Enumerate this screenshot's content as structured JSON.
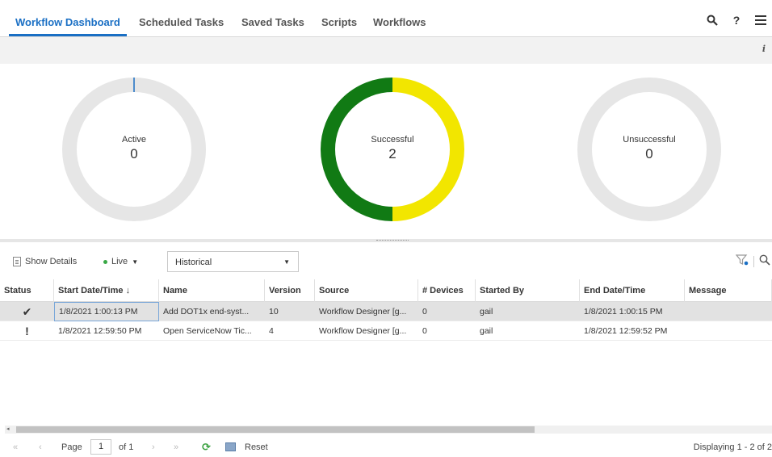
{
  "tabs": [
    {
      "label": "Workflow Dashboard",
      "active": true
    },
    {
      "label": "Scheduled Tasks"
    },
    {
      "label": "Saved Tasks"
    },
    {
      "label": "Scripts"
    },
    {
      "label": "Workflows"
    }
  ],
  "top_icons": [
    "search-icon",
    "help-icon",
    "menu-icon"
  ],
  "info_label": "i",
  "donuts": [
    {
      "label": "Active",
      "value": "0",
      "segments": [
        {
          "fraction": 1.0,
          "color": "#e6e6e6"
        }
      ],
      "marker_color": "#1a6fc4"
    },
    {
      "label": "Successful",
      "value": "2",
      "segments": [
        {
          "fraction": 0.5,
          "color": "#f2e600"
        },
        {
          "fraction": 0.5,
          "color": "#117a14"
        }
      ]
    },
    {
      "label": "Unsuccessful",
      "value": "0",
      "segments": [
        {
          "fraction": 1.0,
          "color": "#e6e6e6"
        }
      ]
    }
  ],
  "toolbar": {
    "show_details": "Show Details",
    "live": "Live",
    "select_value": "Historical"
  },
  "table": {
    "sort_indicator": "↓",
    "headers": [
      "Status",
      "Start Date/Time",
      "Name",
      "Version",
      "Source",
      "# Devices",
      "Started By",
      "End Date/Time",
      "Message"
    ],
    "rows": [
      {
        "status": "✔",
        "start": "1/8/2021 1:00:13 PM",
        "name": "Add DOT1x end-syst...",
        "version": "10",
        "source": "Workflow Designer [g...",
        "devices": "0",
        "started_by": "gail",
        "end": "1/8/2021 1:00:15 PM",
        "message": ""
      },
      {
        "status": "!",
        "start": "1/8/2021 12:59:50 PM",
        "name": "Open ServiceNow Tic...",
        "version": "4",
        "source": "Workflow Designer [g...",
        "devices": "0",
        "started_by": "gail",
        "end": "1/8/2021 12:59:52 PM",
        "message": ""
      }
    ]
  },
  "pager": {
    "first": "«",
    "prev": "‹",
    "page_label": "Page",
    "page_value": "1",
    "of_label": "of 1",
    "next": "›",
    "last": "»",
    "reset": "Reset",
    "displaying": "Displaying 1 - 2 of 2"
  }
}
